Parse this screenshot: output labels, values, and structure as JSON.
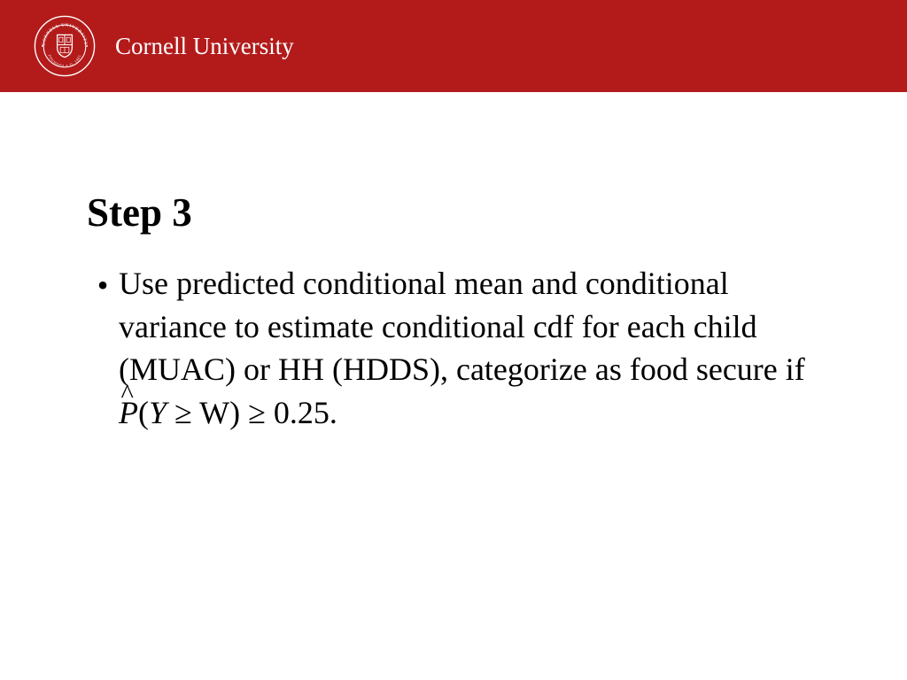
{
  "header": {
    "institution": "Cornell University",
    "seal_text_top": "CORNELL UNIVERSITY",
    "seal_text_bottom": "FOUNDED A.D. 1865"
  },
  "slide": {
    "title": "Step 3",
    "bullet_intro": "Use predicted conditional mean and conditional variance to estimate conditional cdf for each child (MUAC) or HH (HDDS), categorize as food secure if ",
    "formula": {
      "p_hat": "P",
      "open": "(",
      "y": "Y",
      "geq1": " ≥ ",
      "w": "W",
      "close": ")",
      "geq2": " ≥ ",
      "threshold": "0.25",
      "period": "."
    }
  }
}
